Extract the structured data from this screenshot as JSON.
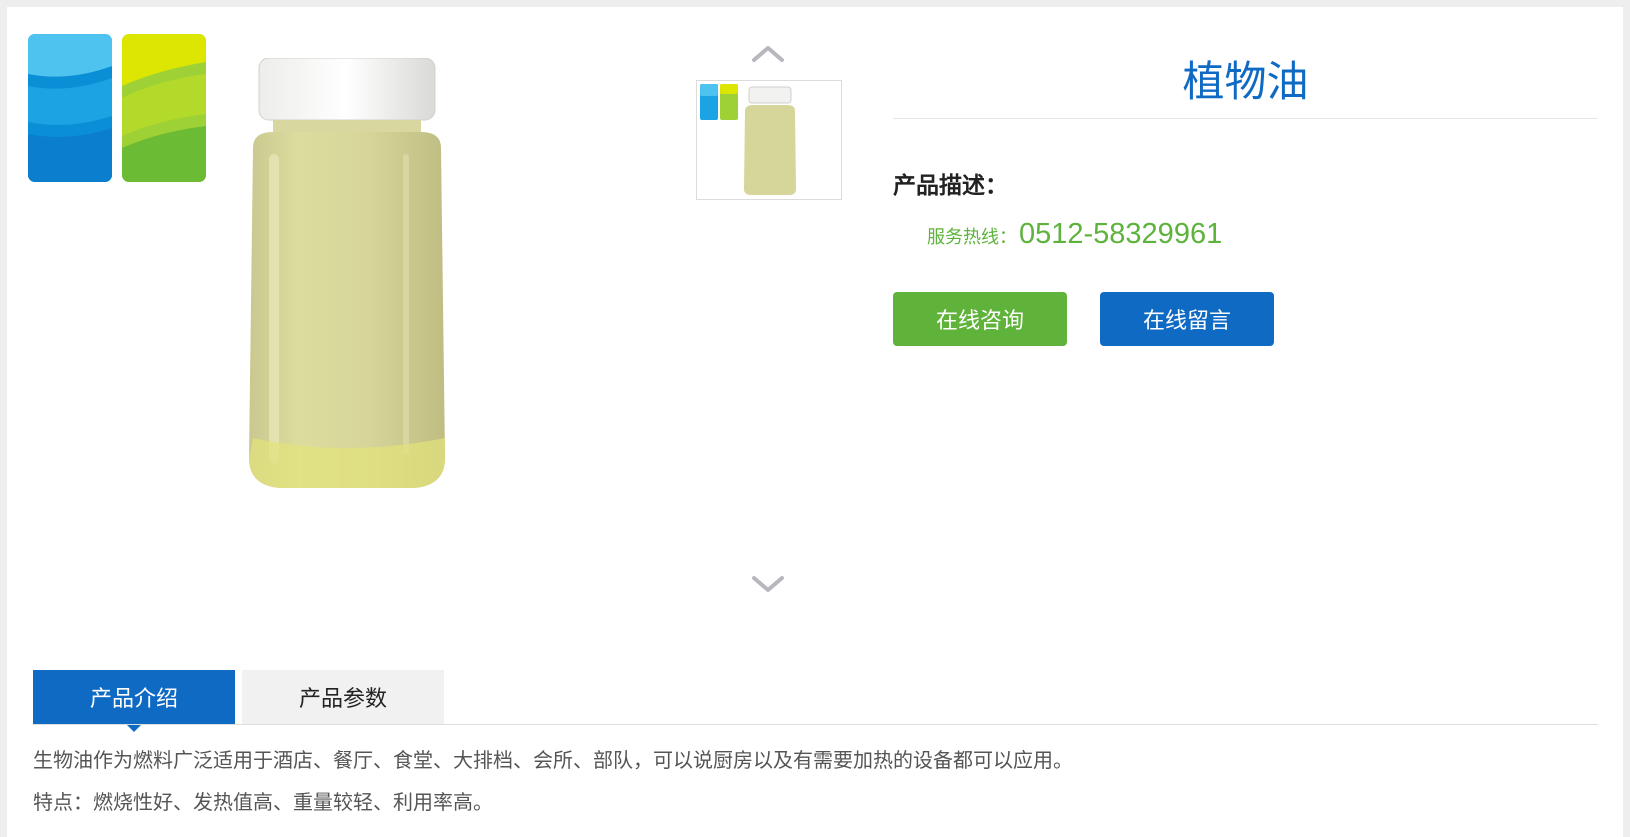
{
  "product": {
    "title": "植物油",
    "description_label": "产品描述："
  },
  "hotline": {
    "label": "服务热线：",
    "number": "0512-58329961"
  },
  "buttons": {
    "consult": "在线咨询",
    "message": "在线留言"
  },
  "tabs": [
    {
      "label": "产品介绍",
      "active": true
    },
    {
      "label": "产品参数",
      "active": false
    }
  ],
  "content": {
    "paragraphs": [
      "生物油作为燃料广泛适用于酒店、餐厅、食堂、大排档、会所、部队，可以说厨房以及有需要加热的设备都可以应用。",
      "特点：燃烧性好、发热值高、重量较轻、利用率高。"
    ]
  },
  "icons": {
    "arrow_up": "chevron-up-icon",
    "arrow_down": "chevron-down-icon"
  },
  "colors": {
    "brand_blue": "#0f6ac4",
    "brand_green": "#5fb33a",
    "hotline_green": "#5db33b"
  }
}
